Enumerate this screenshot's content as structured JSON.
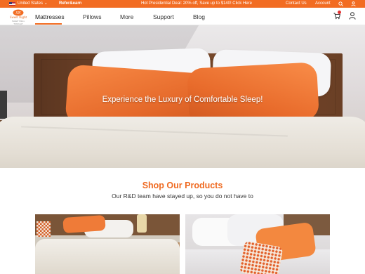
{
  "topbar": {
    "region": "United States ⌄",
    "refer": "Refer&earn",
    "promo": "Hot Presidential Deal: 20% off, Save up to $140! Click Here",
    "contact": "Contact  Us",
    "account": "Account"
  },
  "logo": {
    "brand": "Sweet Night",
    "tagline": "SLEEP WELL TONIGHT"
  },
  "nav": {
    "items": [
      {
        "label": "Mattresses"
      },
      {
        "label": "Pillows"
      },
      {
        "label": "More"
      },
      {
        "label": "Support"
      },
      {
        "label": "Blog"
      }
    ]
  },
  "hero": {
    "headline": "Experience the Luxury of Comfortable Sleep!"
  },
  "products": {
    "title": "Shop Our Products",
    "subtitle": "Our R&D team have stayed up, so you do not have to"
  },
  "colors": {
    "accent": "#f26c22",
    "badge": "#e03030"
  },
  "icons": [
    "us-flag-icon",
    "search-icon",
    "user-icon",
    "cart-icon",
    "account-icon"
  ]
}
